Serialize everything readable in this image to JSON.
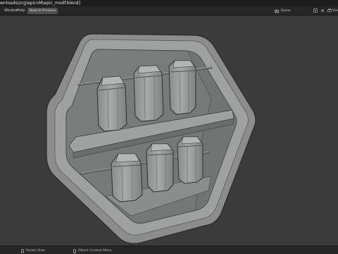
{
  "window": {
    "title": "wnloads\\zcg\\epicnM\\epic_modf.blend]"
  },
  "menubar": {
    "items": [
      "Window",
      "Help"
    ],
    "back_button_label": "Back to Previous",
    "scene_label": "Scene",
    "view_layer_label": "ViewLa"
  },
  "viewport": {
    "background_color": "#3b3b3b",
    "object": "hexagonal shelf with six jars"
  },
  "statusbar": {
    "items": [
      "Rotate View",
      "Object Context Menu"
    ]
  },
  "icons": {
    "scene": "scene-icon",
    "new_scene": "new-scene-icon",
    "delete_scene": "delete-scene-icon",
    "view_layer": "view-layer-icon",
    "mouse": "mouse-icon"
  }
}
